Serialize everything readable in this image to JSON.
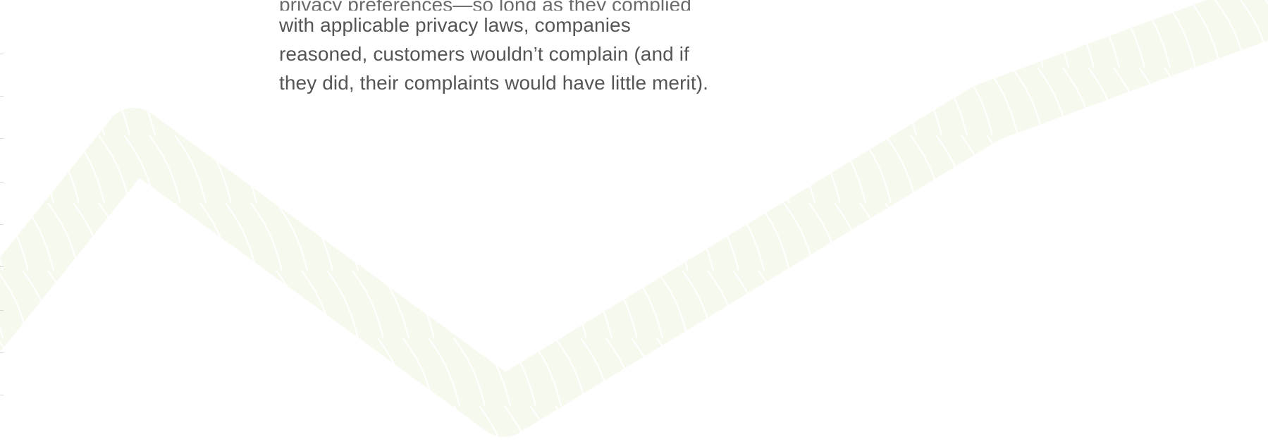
{
  "document": {
    "paragraph_lines": [
      "privacy preferences—so long as they complied",
      "with applicable privacy laws, companies",
      "reasoned, customers wouldn’t complain (and if",
      "they did, their complaints would have little merit)."
    ]
  },
  "decoration": {
    "rope_color": "#f6f9ee",
    "rope_strand_color": "#ffffff",
    "icon": "rope-watermark"
  }
}
